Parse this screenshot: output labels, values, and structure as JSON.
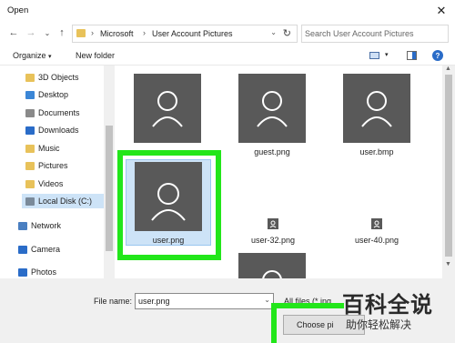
{
  "window": {
    "title": "Open",
    "close_glyph": "✕"
  },
  "nav": {
    "back_glyph": "←",
    "forward_glyph": "→",
    "recent_glyph": "⌄",
    "up_glyph": "↑",
    "breadcrumb": [
      "Microsoft",
      "User Account Pictures"
    ],
    "search_placeholder": "Search User Account Pictures"
  },
  "toolbar": {
    "organize": "Organize",
    "new_folder": "New folder",
    "help": "?"
  },
  "sidebar": {
    "items": [
      {
        "label": "3D Objects",
        "icon": "3d-objects-icon",
        "color": "#e8c25a"
      },
      {
        "label": "Desktop",
        "icon": "desktop-icon",
        "color": "#3b86d6"
      },
      {
        "label": "Documents",
        "icon": "documents-icon",
        "color": "#8a8a8a"
      },
      {
        "label": "Downloads",
        "icon": "downloads-icon",
        "color": "#2a6cc8"
      },
      {
        "label": "Music",
        "icon": "music-icon",
        "color": "#e8c25a"
      },
      {
        "label": "Pictures",
        "icon": "pictures-icon",
        "color": "#e8c25a"
      },
      {
        "label": "Videos",
        "icon": "videos-icon",
        "color": "#e8c25a"
      },
      {
        "label": "Local Disk (C:)",
        "icon": "local-disk-icon",
        "color": "#7a8a9a"
      },
      {
        "label": "Network",
        "icon": "network-icon",
        "color": "#4a7fc1"
      },
      {
        "label": "Camera",
        "icon": "camera-icon",
        "color": "#2a6cc8"
      },
      {
        "label": "Photos",
        "icon": "photos-icon",
        "color": "#2a6cc8"
      }
    ]
  },
  "files": {
    "row1": [
      "guest.png",
      "user.bmp"
    ],
    "selected": "user.png",
    "row2": [
      "user-32.png",
      "user-40.png"
    ]
  },
  "bottom": {
    "file_name_label": "File name:",
    "file_name_value": "user.png",
    "filter_text": "All files (*.ing",
    "choose_button": "Choose pi"
  },
  "highlight_color": "#22e61a",
  "watermark": {
    "big": "百科全说",
    "small": "助你轻松解决"
  }
}
